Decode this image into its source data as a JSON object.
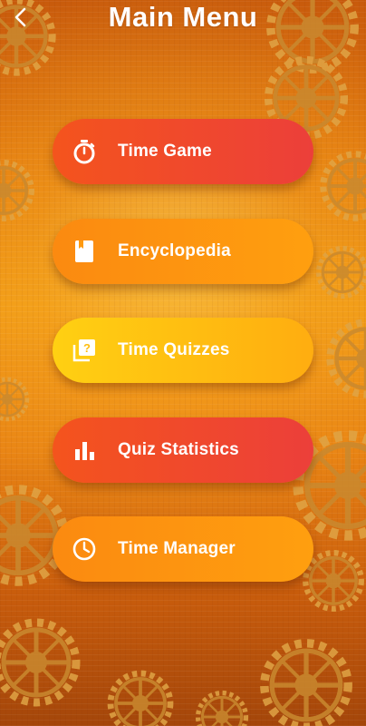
{
  "header": {
    "title": "Main Menu",
    "back_icon": "chevron-left-icon"
  },
  "menu": {
    "items": [
      {
        "label": "Time Game",
        "icon": "stopwatch-icon",
        "color_start": "#f4541d",
        "color_end": "#ec3f3a"
      },
      {
        "label": "Encyclopedia",
        "icon": "book-icon",
        "color_start": "#fb8a10",
        "color_end": "#ff9f0f"
      },
      {
        "label": "Time Quizzes",
        "icon": "quiz-icon",
        "color_start": "#ffd012",
        "color_end": "#ffad10"
      },
      {
        "label": "Quiz Statistics",
        "icon": "bar-chart-icon",
        "color_start": "#f4541d",
        "color_end": "#ec3f3a"
      },
      {
        "label": "Time Manager",
        "icon": "clock-icon",
        "color_start": "#fb8a10",
        "color_end": "#ff9f0f"
      }
    ]
  },
  "theme": {
    "background_top": "#c85a0c",
    "background_mid": "#f09a16",
    "gear_color": "#d89a3a",
    "text_color": "#ffffff"
  }
}
